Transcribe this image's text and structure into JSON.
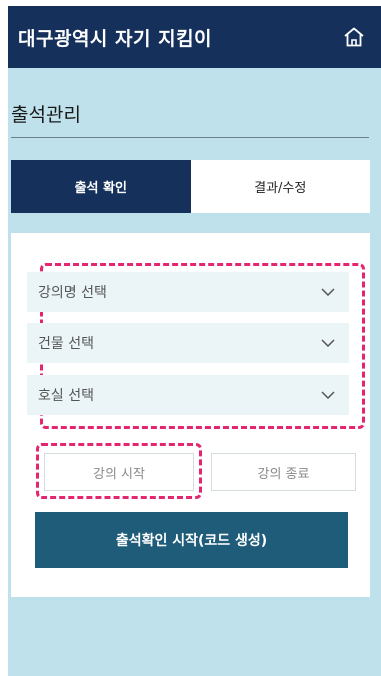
{
  "header": {
    "title": "대구광역시 자기 지킴이",
    "home_icon": "home-icon"
  },
  "section": {
    "title": "출석관리"
  },
  "tabs": [
    {
      "label": "출석 확인",
      "active": true
    },
    {
      "label": "결과/수정",
      "active": false
    }
  ],
  "selects": [
    {
      "label": "강의명 선택",
      "icon": "chevron-down-icon"
    },
    {
      "label": "건물 선택",
      "icon": "chevron-down-icon"
    },
    {
      "label": "호실 선택",
      "icon": "chevron-down-icon"
    }
  ],
  "lecture_buttons": {
    "start": "강의 시작",
    "end": "강의 종료"
  },
  "primary_button": {
    "label": "출석확인 시작(코드 생성)"
  },
  "colors": {
    "header_bg": "#16305c",
    "page_bg": "#bfe1ec",
    "primary_bg": "#1e5c79",
    "highlight_dashed": "#e3266f",
    "select_bg": "#ebf5f8"
  }
}
